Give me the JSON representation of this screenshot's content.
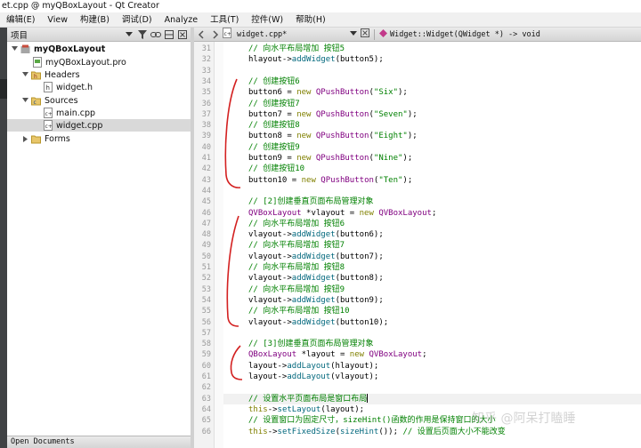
{
  "window": {
    "title": "et.cpp @ myQBoxLayout - Qt Creator"
  },
  "menubar": {
    "items": [
      "编辑(E)",
      "View",
      "构建(B)",
      "调试(D)",
      "Analyze",
      "工具(T)",
      "控件(W)",
      "帮助(H)"
    ]
  },
  "project_panel": {
    "title": "项目",
    "tree": {
      "project": "myQBoxLayout",
      "pro_file": "myQBoxLayout.pro",
      "headers_folder": "Headers",
      "header_file": "widget.h",
      "sources_folder": "Sources",
      "source_files": [
        "main.cpp",
        "widget.cpp"
      ],
      "forms_folder": "Forms"
    },
    "open_documents": "Open Documents"
  },
  "editor": {
    "file_tab": "widget.cpp*",
    "function_combo": "Widget::Widget(QWidget *) -> void",
    "line_numbers": [
      "31",
      "32",
      "33",
      "34",
      "35",
      "36",
      "37",
      "38",
      "39",
      "40",
      "41",
      "42",
      "43",
      "44",
      "45",
      "46",
      "47",
      "48",
      "49",
      "50",
      "51",
      "52",
      "53",
      "54",
      "55",
      "56",
      "57",
      "58",
      "59",
      "60",
      "61",
      "62",
      "63",
      "64",
      "65",
      "66"
    ],
    "cursor_line": "63"
  },
  "colors": {
    "comment": "#008000",
    "keyword": "#808000",
    "type": "#800080",
    "function": "#00677c",
    "annotation": "#d32020"
  },
  "watermark": "知乎 @阿呆打瞌睡"
}
